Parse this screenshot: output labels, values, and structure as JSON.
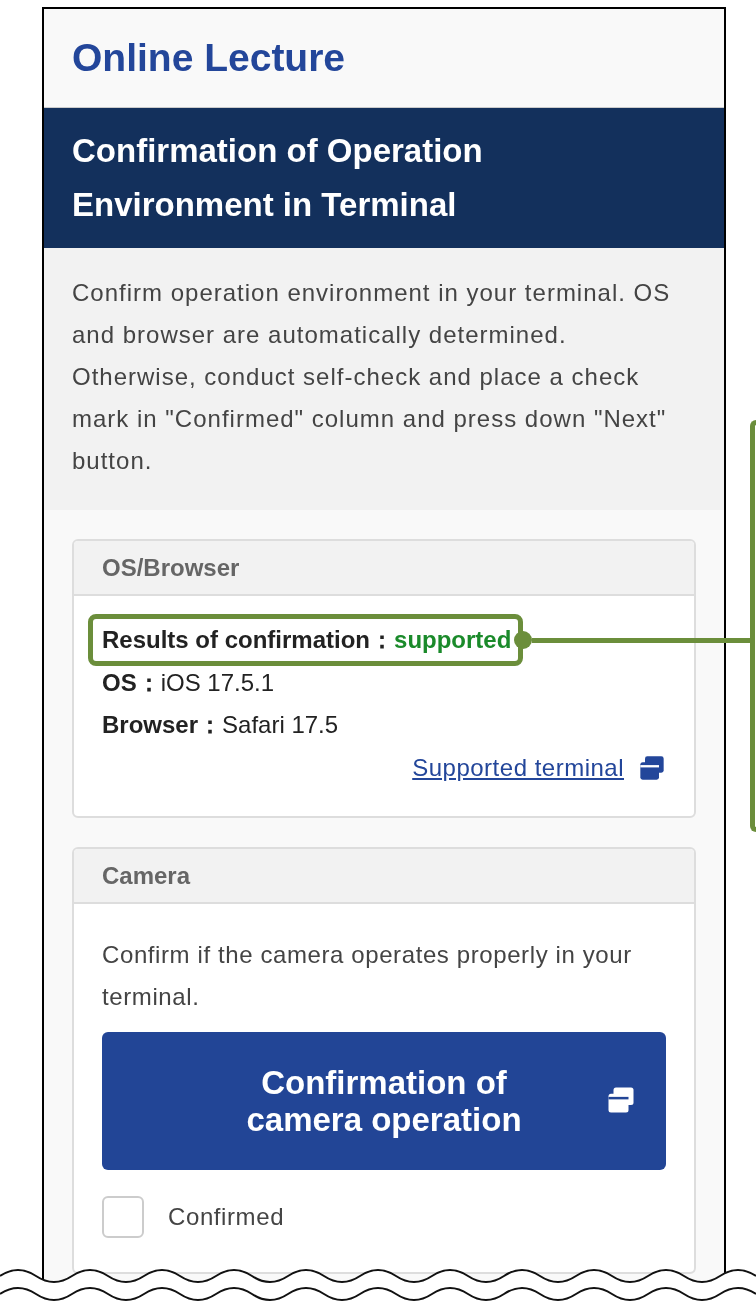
{
  "page_title": "Online Lecture",
  "section_title": "Confirmation of Operation Environment in Terminal",
  "description": "Confirm operation environment in your terminal. OS and browser are automatically determined. Otherwise, conduct self-check and place a check mark in \"Confirmed\" column and press down \"Next\" button.",
  "cards": [
    {
      "kind": "os_browser",
      "title": "OS/Browser",
      "result": {
        "label": "Results of confirmation：",
        "value": "supported"
      },
      "fields": [
        {
          "label": "OS：",
          "value": "iOS 17.5.1"
        },
        {
          "label": "Browser：",
          "value": "Safari 17.5"
        }
      ],
      "link": "Supported terminal"
    },
    {
      "kind": "camera",
      "title": "Camera",
      "text": "Confirm if the camera operates properly in your terminal.",
      "button": "Confirmation of camera operation",
      "checkbox": {
        "label": "Confirmed",
        "checked": false
      }
    }
  ]
}
